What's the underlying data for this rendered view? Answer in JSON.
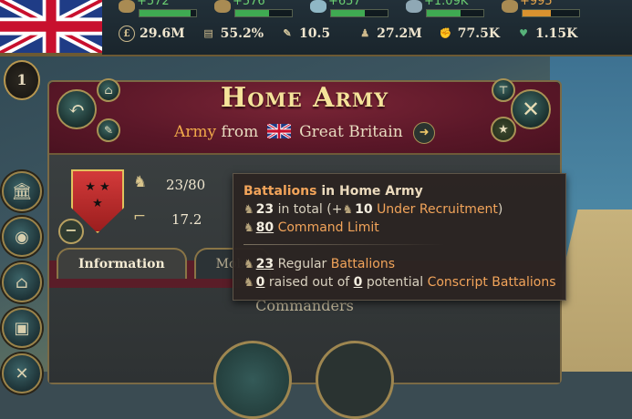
{
  "colors": {
    "accent_orange": "#f2a45a",
    "header_red": "#7a2536",
    "gold": "#f5e39a"
  },
  "topbar": {
    "resources": [
      {
        "icon": "scroll-icon",
        "value": "+572",
        "fill": 0.9
      },
      {
        "icon": "trade-icon",
        "value": "+576",
        "fill": 0.6
      },
      {
        "icon": "dove-icon",
        "value": "+657",
        "fill": 0.6
      },
      {
        "icon": "ship-icon",
        "value": "+1.09K",
        "fill": 0.6
      },
      {
        "icon": "pound-icon",
        "value": "+995",
        "fill": 0.5
      }
    ],
    "stats": [
      {
        "icon": "gdp-icon",
        "value": "29.6M"
      },
      {
        "icon": "literacy-icon",
        "value": "55.2%"
      },
      {
        "icon": "sol-icon",
        "value": "10.5"
      },
      {
        "icon": "population-icon",
        "value": "27.2M"
      },
      {
        "icon": "soldier-icon",
        "value": "77.5K"
      },
      {
        "icon": "heart-icon",
        "value": "1.15K"
      }
    ]
  },
  "rank": "1",
  "panel": {
    "title": "Home Army",
    "subtitle_army": "Army",
    "subtitle_from": "from",
    "subtitle_country": "Great Britain",
    "battalions": "23/80",
    "firepower": "17.2",
    "shield_stars": "★ ★\n★",
    "tabs": [
      "Information",
      "Mobi"
    ],
    "section_label": "Commanders"
  },
  "tooltip": {
    "title_a": "Battalions",
    "title_in": "in",
    "title_b": "Home Army",
    "total_value": "23",
    "total_text": "in total (+",
    "recruit_value": "10",
    "recruit_label": "Under Recruitment",
    "recruit_close": ")",
    "limit_value": "80",
    "limit_label": "Command Limit",
    "regular_value": "23",
    "regular_text": "Regular",
    "regular_label": "Battalions",
    "conscript_value_a": "0",
    "conscript_text_a": "raised out of",
    "conscript_value_b": "0",
    "conscript_text_b": "potential",
    "conscript_label": "Conscript Battalions"
  }
}
